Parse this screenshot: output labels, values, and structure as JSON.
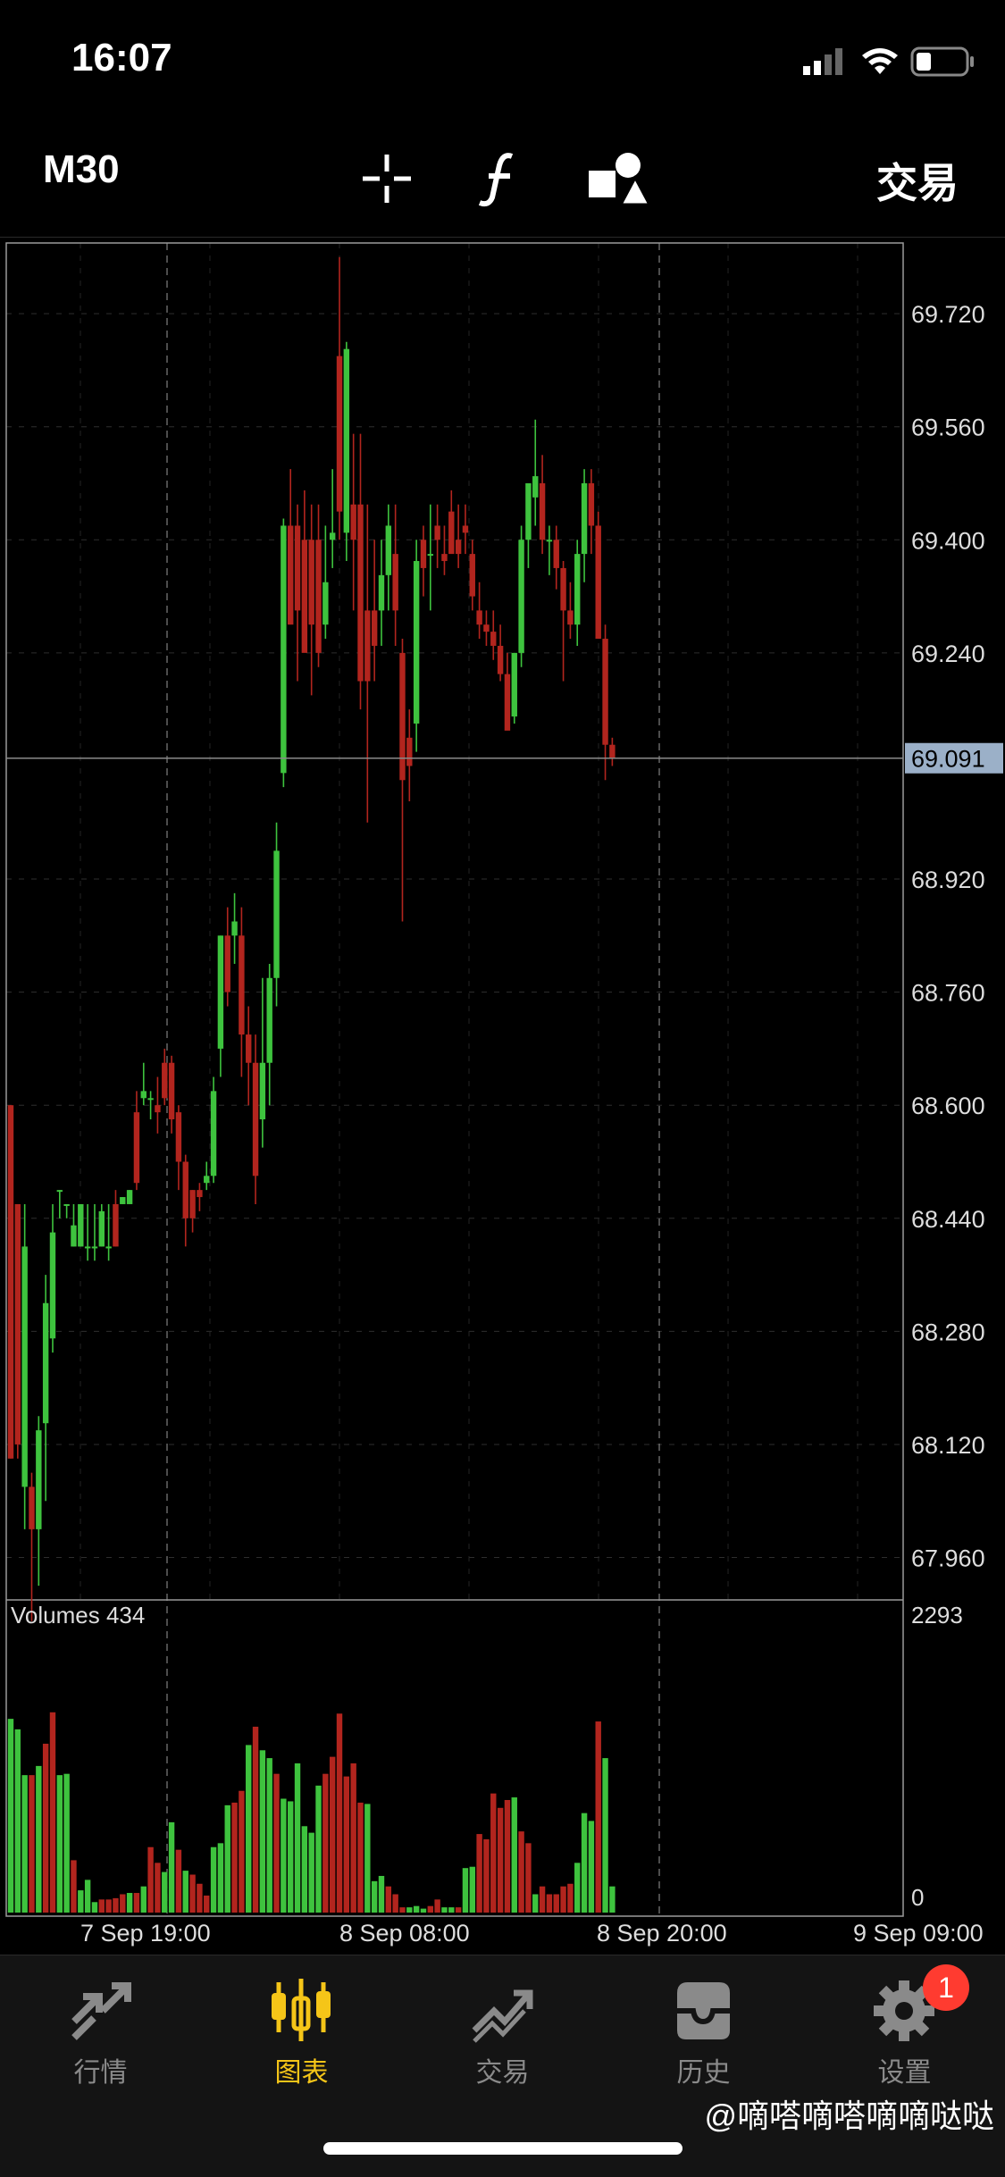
{
  "status_bar": {
    "time": "16:07"
  },
  "toolbar": {
    "timeframe": "M30",
    "trade_label": "交易",
    "icons": [
      "crosshair-icon",
      "function-icon",
      "shapes-icon"
    ]
  },
  "chart_data": {
    "type": "candlestick",
    "y_ticks": [
      "69.720",
      "69.560",
      "69.400",
      "69.240",
      "68.920",
      "68.760",
      "68.600",
      "68.440",
      "68.280",
      "68.120",
      "67.960"
    ],
    "y_range": [
      67.9,
      69.82
    ],
    "current_price": "69.091",
    "x_labels": [
      "7 Sep 19:00",
      "8 Sep 08:00",
      "8 Sep 20:00",
      "9 Sep 09:00"
    ],
    "volume_label": "Volumes 434",
    "volume_ticks": [
      "2293",
      "0"
    ],
    "volume_max": 2293,
    "up_color": "#3ec33e",
    "down_color": "#b2251e",
    "candles": [
      [
        68.6,
        68.6,
        68.1,
        68.1
      ],
      [
        68.46,
        68.46,
        68.1,
        68.12
      ],
      [
        68.06,
        68.46,
        68.0,
        68.4
      ],
      [
        68.06,
        68.08,
        67.87,
        68.0
      ],
      [
        68.0,
        68.16,
        67.92,
        68.14
      ],
      [
        68.15,
        68.36,
        68.04,
        68.32
      ],
      [
        68.27,
        68.46,
        68.25,
        68.42
      ],
      [
        68.48,
        68.48,
        68.44,
        68.48
      ],
      [
        68.46,
        68.46,
        68.44,
        68.46
      ],
      [
        68.4,
        68.46,
        68.4,
        68.43
      ],
      [
        68.4,
        68.46,
        68.4,
        68.46
      ],
      [
        68.4,
        68.46,
        68.38,
        68.4
      ],
      [
        68.4,
        68.46,
        68.38,
        68.4
      ],
      [
        68.4,
        68.46,
        68.4,
        68.45
      ],
      [
        68.4,
        68.46,
        68.38,
        68.4
      ],
      [
        68.46,
        68.48,
        68.4,
        68.4
      ],
      [
        68.46,
        68.47,
        68.46,
        68.47
      ],
      [
        68.46,
        68.48,
        68.46,
        68.48
      ],
      [
        68.59,
        68.62,
        68.48,
        68.49
      ],
      [
        68.61,
        68.66,
        68.6,
        68.62
      ],
      [
        68.61,
        68.62,
        68.58,
        68.61
      ],
      [
        68.6,
        68.64,
        68.56,
        68.59
      ],
      [
        68.66,
        68.68,
        68.6,
        68.61
      ],
      [
        68.66,
        68.67,
        68.56,
        68.58
      ],
      [
        68.59,
        68.6,
        68.48,
        68.52
      ],
      [
        68.52,
        68.53,
        68.4,
        68.44
      ],
      [
        68.48,
        68.48,
        68.42,
        68.44
      ],
      [
        68.48,
        68.49,
        68.45,
        68.47
      ],
      [
        68.49,
        68.52,
        68.48,
        68.5
      ],
      [
        68.5,
        68.64,
        68.49,
        68.62
      ],
      [
        68.68,
        68.84,
        68.64,
        68.84
      ],
      [
        68.84,
        68.88,
        68.74,
        68.76
      ],
      [
        68.84,
        68.9,
        68.8,
        68.86
      ],
      [
        68.84,
        68.88,
        68.64,
        68.7
      ],
      [
        68.7,
        68.74,
        68.6,
        68.66
      ],
      [
        68.66,
        68.7,
        68.46,
        68.5
      ],
      [
        68.58,
        68.78,
        68.54,
        68.66
      ],
      [
        68.66,
        68.8,
        68.6,
        68.78
      ],
      [
        68.78,
        69.0,
        68.74,
        68.96
      ],
      [
        69.07,
        69.43,
        69.05,
        69.42
      ],
      [
        69.42,
        69.5,
        69.3,
        69.28
      ],
      [
        69.42,
        69.45,
        69.2,
        69.3
      ],
      [
        69.4,
        69.47,
        69.3,
        69.24
      ],
      [
        69.4,
        69.45,
        69.18,
        69.28
      ],
      [
        69.4,
        69.45,
        69.22,
        69.24
      ],
      [
        69.28,
        69.42,
        69.26,
        69.34
      ],
      [
        69.4,
        69.5,
        69.36,
        69.41
      ],
      [
        69.66,
        69.8,
        69.4,
        69.44
      ],
      [
        69.41,
        69.68,
        69.37,
        69.67
      ],
      [
        69.45,
        69.55,
        69.3,
        69.4
      ],
      [
        69.45,
        69.55,
        69.16,
        69.2
      ],
      [
        69.3,
        69.45,
        69.0,
        69.2
      ],
      [
        69.3,
        69.4,
        69.2,
        69.25
      ],
      [
        69.3,
        69.4,
        69.25,
        69.35
      ],
      [
        69.35,
        69.45,
        69.3,
        69.42
      ],
      [
        69.38,
        69.45,
        69.25,
        69.3
      ],
      [
        69.24,
        69.26,
        68.86,
        69.06
      ],
      [
        69.12,
        69.16,
        69.03,
        69.08
      ],
      [
        69.14,
        69.4,
        69.1,
        69.37
      ],
      [
        69.4,
        69.42,
        69.32,
        69.36
      ],
      [
        69.38,
        69.45,
        69.3,
        69.38
      ],
      [
        69.42,
        69.45,
        69.36,
        69.4
      ],
      [
        69.38,
        69.42,
        69.35,
        69.37
      ],
      [
        69.44,
        69.47,
        69.4,
        69.38
      ],
      [
        69.4,
        69.45,
        69.36,
        69.38
      ],
      [
        69.42,
        69.45,
        69.38,
        69.41
      ],
      [
        69.38,
        69.4,
        69.3,
        69.32
      ],
      [
        69.3,
        69.34,
        69.26,
        69.28
      ],
      [
        69.28,
        69.3,
        69.25,
        69.27
      ],
      [
        69.27,
        69.3,
        69.23,
        69.25
      ],
      [
        69.25,
        69.28,
        69.2,
        69.21
      ],
      [
        69.21,
        69.24,
        69.16,
        69.13
      ],
      [
        69.15,
        69.24,
        69.14,
        69.24
      ],
      [
        69.24,
        69.42,
        69.22,
        69.4
      ],
      [
        69.4,
        69.48,
        69.36,
        69.48
      ],
      [
        69.46,
        69.57,
        69.42,
        69.49
      ],
      [
        69.48,
        69.52,
        69.38,
        69.4
      ],
      [
        69.4,
        69.42,
        69.35,
        69.4
      ],
      [
        69.4,
        69.42,
        69.33,
        69.36
      ],
      [
        69.36,
        69.37,
        69.2,
        69.3
      ],
      [
        69.3,
        69.34,
        69.26,
        69.28
      ],
      [
        69.28,
        69.4,
        69.25,
        69.38
      ],
      [
        69.38,
        69.5,
        69.34,
        69.48
      ],
      [
        69.48,
        69.5,
        69.38,
        69.42
      ],
      [
        69.42,
        69.44,
        69.26,
        69.26
      ],
      [
        69.26,
        69.28,
        69.06,
        69.11
      ],
      [
        69.11,
        69.12,
        69.08,
        69.09
      ]
    ],
    "volumes": [
      1480,
      1400,
      1050,
      1050,
      1120,
      1290,
      1530,
      1050,
      1060,
      400,
      170,
      250,
      80,
      100,
      100,
      110,
      140,
      150,
      150,
      200,
      500,
      380,
      310,
      690,
      480,
      320,
      290,
      220,
      130,
      500,
      530,
      820,
      840,
      930,
      1280,
      1420,
      1240,
      1180,
      1060,
      870,
      850,
      1140,
      660,
      610,
      970,
      1060,
      1190,
      1520,
      1040,
      1140,
      840,
      830,
      240,
      280,
      200,
      140,
      40,
      40,
      50,
      30,
      50,
      100,
      40,
      40,
      40,
      340,
      350,
      600,
      560,
      910,
      800,
      860,
      880,
      620,
      530,
      140,
      200,
      140,
      140,
      200,
      220,
      380,
      760,
      700,
      1460,
      1180,
      200
    ],
    "vol_colors": [
      "u",
      "u",
      "u",
      "d",
      "u",
      "d",
      "d",
      "u",
      "u",
      "d",
      "u",
      "u",
      "u",
      "d",
      "d",
      "d",
      "d",
      "u",
      "d",
      "u",
      "d",
      "d",
      "u",
      "u",
      "d",
      "u",
      "d",
      "d",
      "d",
      "u",
      "u",
      "u",
      "d",
      "d",
      "u",
      "d",
      "u",
      "u",
      "d",
      "u",
      "u",
      "u",
      "u",
      "u",
      "u",
      "d",
      "d",
      "d",
      "d",
      "d",
      "d",
      "u",
      "u",
      "u",
      "d",
      "d",
      "d",
      "u",
      "u",
      "u",
      "d",
      "d",
      "u",
      "u",
      "d",
      "u",
      "u",
      "d",
      "d",
      "d",
      "d",
      "d",
      "u",
      "d",
      "d",
      "u",
      "d",
      "d",
      "d",
      "d",
      "d",
      "u",
      "u",
      "u",
      "d",
      "u",
      "u"
    ]
  },
  "tabs": [
    {
      "label": "行情",
      "icon": "quotes-icon"
    },
    {
      "label": "图表",
      "icon": "chart-icon"
    },
    {
      "label": "交易",
      "icon": "trade-icon"
    },
    {
      "label": "历史",
      "icon": "history-icon"
    },
    {
      "label": "设置",
      "icon": "settings-icon"
    }
  ],
  "settings_badge": "1",
  "watermark": "@嘀嗒嘀嗒嘀嘀哒哒"
}
